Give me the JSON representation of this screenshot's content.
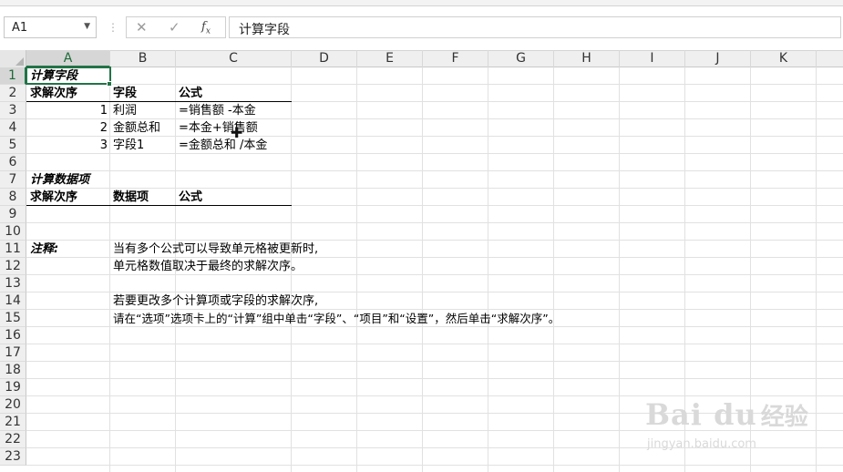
{
  "formula_bar": {
    "name_box": "A1",
    "cancel_icon": "close-icon",
    "enter_icon": "check-icon",
    "fx_label": "fx",
    "content": "计算字段"
  },
  "columns": [
    "A",
    "B",
    "C",
    "D",
    "E",
    "F",
    "G",
    "H",
    "I",
    "J",
    "K"
  ],
  "rows": [
    "1",
    "2",
    "3",
    "4",
    "5",
    "6",
    "7",
    "8",
    "9",
    "10",
    "11",
    "12",
    "13",
    "14",
    "15",
    "16",
    "17",
    "18",
    "19",
    "20",
    "21",
    "22",
    "23"
  ],
  "cells": {
    "A1": "计算字段",
    "A2": "求解次序",
    "B2": "字段",
    "C2": "公式",
    "A3": "1",
    "B3": "利润",
    "C3": "=销售额 -本金",
    "A4": "2",
    "B4": "金额总和",
    "C4": "=本金+销售额",
    "A5": "3",
    "B5": "字段1",
    "C5": "=金额总和 /本金",
    "A7": "计算数据项",
    "A8": "求解次序",
    "B8": "数据项",
    "C8": "公式",
    "A11": "注释:",
    "B11": "当有多个公式可以导致单元格被更新时,",
    "B12": "单元格数值取决于最终的求解次序。",
    "B14": "若要更改多个计算项或字段的求解次序,",
    "B15": "请在“选项”选项卡上的“计算”组中单击“字段”、“项目”和“设置”，然后单击“求解次序”。"
  },
  "watermark": {
    "logo": "Bai du",
    "cn": "经验",
    "url": "jingyan.baidu.com"
  },
  "colors": {
    "accent": "#217346",
    "header_bg": "#efefef",
    "gridline": "#e1e1e1"
  }
}
